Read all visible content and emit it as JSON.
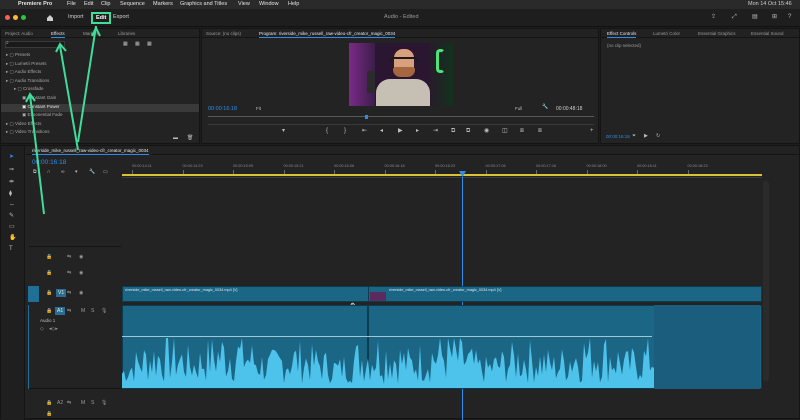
{
  "menubar": {
    "app": "Premiere Pro",
    "items": [
      "File",
      "Edit",
      "Clip",
      "Sequence",
      "Markers",
      "Graphics and Titles",
      "View",
      "Window",
      "Help"
    ],
    "clock": "Mon 14 Oct 15:46"
  },
  "appbar": {
    "workspaces": [
      "Import",
      "Edit",
      "Export"
    ],
    "active_workspace": "Edit",
    "title": "Audio - Edited"
  },
  "effects_panel": {
    "tabs": [
      "Project: Audio",
      "Effects",
      "Markers",
      "Libraries"
    ],
    "search_value": "",
    "tree": [
      {
        "label": "Presets",
        "level": 0
      },
      {
        "label": "Lumetri Presets",
        "level": 0
      },
      {
        "label": "Audio Effects",
        "level": 0
      },
      {
        "label": "Audio Transitions",
        "level": 0
      },
      {
        "label": "Crossfade",
        "level": 1
      },
      {
        "label": "Constant Gain",
        "level": 2
      },
      {
        "label": "Constant Power",
        "level": 2,
        "selected": true
      },
      {
        "label": "Exponential Fade",
        "level": 2
      },
      {
        "label": "Video Effects",
        "level": 0
      },
      {
        "label": "Video Transitions",
        "level": 0
      }
    ]
  },
  "source_panel": {
    "tab": "Source: (no clips)"
  },
  "program_panel": {
    "tab": "Program: riverside_mike_russell_raw-video-cfr_creator_magic_0034",
    "timecode": "00:00:16:18",
    "fit": "Fit",
    "quality": "Full",
    "duration": "00:00:48:18"
  },
  "effect_controls": {
    "tabs": [
      "Effect Controls",
      "Lumetri Color",
      "Essential Graphics",
      "Essential Sound"
    ],
    "empty_text": "(no clip selected)",
    "timecode": "00:00:16:18"
  },
  "timeline": {
    "tab": "riverside_mike_russell_raw-video-cfr_creator_magic_0034",
    "timecode": "00:00:16:18",
    "ruler": [
      "00:00:14:11",
      "00:00:14:23",
      "00:00:15:09",
      "00:00:15:21",
      "00:00:16:06",
      "00:00:16:18",
      "00:00:16:23",
      "00:00:17:06",
      "00:00:17:16",
      "00:00:18:00",
      "00:00:18:11",
      "00:00:18:23"
    ],
    "video_clip_left": "riverside_mike_russell_raw-video-cfr_creator_magic_0034.mp4 [V]",
    "video_clip_right": "riverside_mike_russell_raw-video-cfr_creator_magic_0034.mp4 [V]",
    "audio_track_label": "Audio 1",
    "track_names": {
      "v1": "V1",
      "a1": "A1",
      "a2": "A2"
    }
  },
  "colors": {
    "accent": "#2d8ceb",
    "clip": "#1b6585",
    "waveform": "#4dc2ea",
    "annotation": "#3fdc9a"
  },
  "icons": [
    "apple-icon",
    "search-icon",
    "home-icon",
    "wrench-icon",
    "magnet-icon",
    "selection-tool-icon",
    "razor-tool-icon",
    "hand-tool-icon",
    "type-tool-icon",
    "play-icon",
    "step-back-icon",
    "step-forward-icon",
    "lock-icon",
    "eye-icon",
    "mute-icon",
    "solo-icon",
    "mic-icon"
  ]
}
